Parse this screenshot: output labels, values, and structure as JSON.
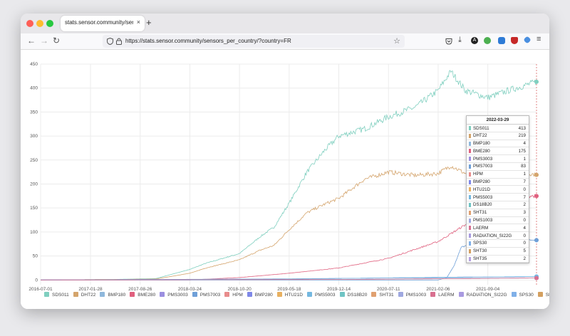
{
  "browser": {
    "tab_title": "stats.sensor.community/sensors_per_country/?country=FR",
    "new_tab_symbol": "+",
    "close_symbol": "×",
    "url": "https://stats.sensor.community/sensors_per_country/?country=FR",
    "toolbar_icons": [
      "pocket-icon",
      "download-icon",
      "account-a-icon",
      "extension-green-icon",
      "extension-blue-icon",
      "ublock-icon",
      "extension-diamond-icon",
      "menu-icon"
    ]
  },
  "tooltip": {
    "date": "2022-03-29",
    "rows": [
      {
        "name": "SDS011",
        "value": "413",
        "color": "#7fcfbf"
      },
      {
        "name": "DHT22",
        "value": "219",
        "color": "#d4a46c"
      },
      {
        "name": "BMP180",
        "value": "4",
        "color": "#8fb8dc"
      },
      {
        "name": "BME280",
        "value": "175",
        "color": "#e0607e"
      },
      {
        "name": "PMS3003",
        "value": "1",
        "color": "#9b8fe0"
      },
      {
        "name": "PMS7003",
        "value": "83",
        "color": "#6fa0d8"
      },
      {
        "name": "HPM",
        "value": "1",
        "color": "#e88c8c"
      },
      {
        "name": "BMP280",
        "value": "7",
        "color": "#7f88e8"
      },
      {
        "name": "HTU21D",
        "value": "0",
        "color": "#e8b060"
      },
      {
        "name": "PMS5003",
        "value": "7",
        "color": "#74b8e0"
      },
      {
        "name": "DS18B20",
        "value": "2",
        "color": "#6fc4c4"
      },
      {
        "name": "SHT31",
        "value": "3",
        "color": "#e0a070"
      },
      {
        "name": "PMS1003",
        "value": "0",
        "color": "#9fa8e0"
      },
      {
        "name": "LAERM",
        "value": "4",
        "color": "#d87090"
      },
      {
        "name": "RADIATION_SI22G",
        "value": "0",
        "color": "#a89ae0"
      },
      {
        "name": "SPS30",
        "value": "0",
        "color": "#80b0e8"
      },
      {
        "name": "SHT30",
        "value": "5",
        "color": "#d4a060"
      },
      {
        "name": "SHT35",
        "value": "2",
        "color": "#b4a0e0"
      }
    ]
  },
  "chart_data": {
    "type": "line",
    "x_ticks": [
      "2016-07-01",
      "2017-01-28",
      "2017-08-26",
      "2018-03-24",
      "2018-10-20",
      "2019-05-18",
      "2019-12-14",
      "2020-07-11",
      "2021-02-06",
      "2021-09-04"
    ],
    "y_ticks": [
      "0",
      "50",
      "100",
      "150",
      "200",
      "250",
      "300",
      "350",
      "400",
      "450"
    ],
    "ylim": [
      -10,
      450
    ],
    "xlim": [
      "2016-07-01",
      "2022-03-29"
    ],
    "series": [
      {
        "name": "SDS011",
        "color": "#7fcfbf",
        "points": [
          [
            "2016-07-01",
            0
          ],
          [
            "2017-05-01",
            1
          ],
          [
            "2017-11-01",
            3
          ],
          [
            "2018-03-24",
            22
          ],
          [
            "2018-06-01",
            35
          ],
          [
            "2018-10-20",
            55
          ],
          [
            "2019-01-15",
            90
          ],
          [
            "2019-03-15",
            110
          ],
          [
            "2019-05-18",
            160
          ],
          [
            "2019-08-01",
            225
          ],
          [
            "2019-10-15",
            270
          ],
          [
            "2019-12-14",
            300
          ],
          [
            "2020-04-01",
            315
          ],
          [
            "2020-07-11",
            340
          ],
          [
            "2020-11-01",
            360
          ],
          [
            "2021-02-06",
            395
          ],
          [
            "2021-04-01",
            435
          ],
          [
            "2021-06-01",
            395
          ],
          [
            "2021-09-04",
            380
          ],
          [
            "2021-12-01",
            395
          ],
          [
            "2022-03-29",
            413
          ]
        ]
      },
      {
        "name": "DHT22",
        "color": "#d4a46c",
        "points": [
          [
            "2016-07-01",
            0
          ],
          [
            "2017-05-01",
            1
          ],
          [
            "2017-11-01",
            2
          ],
          [
            "2018-03-24",
            14
          ],
          [
            "2018-06-01",
            25
          ],
          [
            "2018-10-20",
            42
          ],
          [
            "2019-01-15",
            62
          ],
          [
            "2019-03-15",
            72
          ],
          [
            "2019-05-18",
            105
          ],
          [
            "2019-08-01",
            140
          ],
          [
            "2019-10-15",
            158
          ],
          [
            "2019-12-14",
            170
          ],
          [
            "2020-04-01",
            210
          ],
          [
            "2020-07-11",
            225
          ],
          [
            "2020-11-01",
            218
          ],
          [
            "2021-02-06",
            222
          ],
          [
            "2021-04-01",
            238
          ],
          [
            "2021-06-01",
            222
          ],
          [
            "2021-09-04",
            212
          ],
          [
            "2021-12-01",
            230
          ],
          [
            "2022-03-29",
            219
          ]
        ]
      },
      {
        "name": "BME280",
        "color": "#e0607e",
        "points": [
          [
            "2016-07-01",
            0
          ],
          [
            "2018-03-24",
            0
          ],
          [
            "2018-10-20",
            5
          ],
          [
            "2019-05-18",
            14
          ],
          [
            "2019-12-14",
            25
          ],
          [
            "2020-07-11",
            45
          ],
          [
            "2021-02-06",
            80
          ],
          [
            "2021-06-01",
            115
          ],
          [
            "2021-09-04",
            150
          ],
          [
            "2021-12-01",
            175
          ],
          [
            "2022-03-29",
            175
          ]
        ]
      },
      {
        "name": "PMS7003",
        "color": "#6fa0d8",
        "points": [
          [
            "2016-07-01",
            0
          ],
          [
            "2021-02-06",
            0
          ],
          [
            "2021-03-15",
            5
          ],
          [
            "2021-04-15",
            30
          ],
          [
            "2021-05-15",
            68
          ],
          [
            "2021-08-01",
            82
          ],
          [
            "2022-03-29",
            83
          ]
        ]
      },
      {
        "name": "BMP180",
        "color": "#8fb8dc",
        "points": [
          [
            "2016-07-01",
            0
          ],
          [
            "2019-01-01",
            2
          ],
          [
            "2020-07-11",
            4
          ],
          [
            "2022-03-29",
            4
          ]
        ]
      },
      {
        "name": "BMP280",
        "color": "#7f88e8",
        "points": [
          [
            "2016-07-01",
            0
          ],
          [
            "2019-06-01",
            2
          ],
          [
            "2021-06-01",
            6
          ],
          [
            "2022-03-29",
            7
          ]
        ]
      },
      {
        "name": "PMS5003",
        "color": "#74b8e0",
        "points": [
          [
            "2016-07-01",
            0
          ],
          [
            "2019-06-01",
            2
          ],
          [
            "2021-06-01",
            6
          ],
          [
            "2022-03-29",
            7
          ]
        ]
      },
      {
        "name": "LAERM",
        "color": "#d87090",
        "points": [
          [
            "2016-07-01",
            0
          ],
          [
            "2020-01-01",
            1
          ],
          [
            "2022-03-29",
            4
          ]
        ]
      }
    ]
  },
  "legend": [
    "SDS011",
    "DHT22",
    "BMP180",
    "BME280",
    "PMS3003",
    "PMS7003",
    "HPM",
    "BMP280",
    "HTU21D",
    "PMS5003",
    "DS18B20",
    "SHT31",
    "PMS1003",
    "LAERM",
    "RADIATION_SI22G",
    "SPS30",
    "SHT30",
    "SHT35"
  ],
  "legend_colors": [
    "#7fcfbf",
    "#d4a46c",
    "#8fb8dc",
    "#e0607e",
    "#9b8fe0",
    "#6fa0d8",
    "#e88c8c",
    "#7f88e8",
    "#e8b060",
    "#74b8e0",
    "#6fc4c4",
    "#e0a070",
    "#9fa8e0",
    "#d87090",
    "#a89ae0",
    "#80b0e8",
    "#d4a060",
    "#b4a0e0"
  ]
}
